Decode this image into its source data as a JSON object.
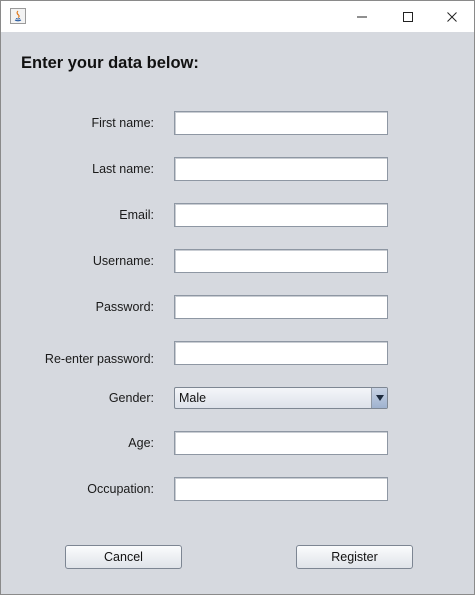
{
  "window": {
    "title": "",
    "controls": [
      "minimize-icon",
      "maximize-icon",
      "close-icon"
    ]
  },
  "form": {
    "heading": "Enter your data below:",
    "fields": {
      "first_name": {
        "label": "First name:",
        "value": ""
      },
      "last_name": {
        "label": "Last name:",
        "value": ""
      },
      "email": {
        "label": "Email:",
        "value": ""
      },
      "username": {
        "label": "Username:",
        "value": ""
      },
      "password": {
        "label": "Password:",
        "value": ""
      },
      "reenter_password": {
        "label": "Re-enter password:",
        "value": ""
      },
      "gender": {
        "label": "Gender:",
        "selected": "Male"
      },
      "age": {
        "label": "Age:",
        "value": ""
      },
      "occupation": {
        "label": "Occupation:",
        "value": ""
      }
    }
  },
  "buttons": {
    "cancel": "Cancel",
    "register": "Register"
  }
}
